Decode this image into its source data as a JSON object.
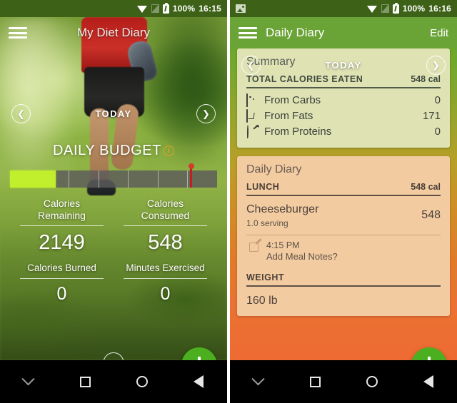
{
  "colors": {
    "brand_green": "#6aa336",
    "status_bar": "#3f6318",
    "fab_green": "#4caf20",
    "progress_fill": "#c2ef2d",
    "progress_marker": "#c22020",
    "info_orange": "#e8a02c",
    "summary_card": "#dfe3b4",
    "diary_card": "#f3cba1"
  },
  "left_phone": {
    "status_bar": {
      "wifi_icon": "wifi-icon",
      "sim_icon": "sim-signal-icon",
      "battery_icon": "battery-charging-icon",
      "battery_text": "100%",
      "time": "16:15"
    },
    "appbar": {
      "menu_icon": "hamburger-menu-icon",
      "title": "My Diet Diary"
    },
    "daynav": {
      "prev_icon": "chevron-left-icon",
      "label": "TODAY",
      "next_icon": "chevron-right-icon"
    },
    "budget": {
      "title": "DAILY BUDGET",
      "info_icon": "info-icon",
      "progress_percent": 22,
      "marker_percent": 87,
      "segments": 7
    },
    "stats": [
      {
        "label": "Calories\nRemaining",
        "value": "2149"
      },
      {
        "label": "Calories\nConsumed",
        "value": "548"
      },
      {
        "label": "Calories Burned",
        "value": "0"
      },
      {
        "label": "Minutes Exercised",
        "value": "0"
      }
    ],
    "stats_row1": {
      "left_label_line1": "Calories",
      "left_label_line2": "Remaining",
      "left_value": "2149",
      "right_label_line1": "Calories",
      "right_label_line2": "Consumed",
      "right_value": "548"
    },
    "stats_row2": {
      "left_label": "Calories Burned",
      "left_value": "0",
      "right_label": "Minutes Exercised",
      "right_value": "0"
    },
    "up_button_icon": "scroll-up-icon",
    "fab_icon": "add-plus-icon",
    "navbar": {
      "collapse_icon": "chevron-down-icon",
      "recents_icon": "recents-square-icon",
      "home_icon": "home-circle-icon",
      "back_icon": "back-triangle-icon"
    }
  },
  "right_phone": {
    "status_bar": {
      "notification_icon": "photo-notification-icon",
      "wifi_icon": "wifi-icon",
      "sim_icon": "sim-signal-icon",
      "battery_icon": "battery-charging-icon",
      "battery_text": "100%",
      "time": "16:16"
    },
    "appbar": {
      "menu_icon": "hamburger-menu-icon",
      "title": "Daily Diary",
      "action": "Edit"
    },
    "daynav": {
      "prev_icon": "chevron-left-icon",
      "label": "TODAY",
      "next_icon": "chevron-right-icon"
    },
    "summary_card": {
      "title": "Summary",
      "total_label": "TOTAL CALORIES EATEN",
      "total_value": "548 cal",
      "macros": [
        {
          "icon": "bread-slice-icon",
          "name": "From Carbs",
          "value": "0"
        },
        {
          "icon": "butter-block-icon",
          "name": "From Fats",
          "value": "171"
        },
        {
          "icon": "drumstick-icon",
          "name": "From Proteins",
          "value": "0"
        }
      ]
    },
    "diary_card": {
      "title": "Daily Diary",
      "lunch": {
        "label": "LUNCH",
        "value": "548 cal",
        "entry": {
          "name": "Cheeseburger",
          "serving": "1.0 serving",
          "calories": "548"
        },
        "note": {
          "icon": "meal-note-edit-icon",
          "time": "4:15 PM",
          "text": "Add Meal Notes?"
        }
      },
      "weight": {
        "label": "WEIGHT",
        "value": "160 lb"
      }
    },
    "fab_icon": "add-plus-icon",
    "navbar": {
      "collapse_icon": "chevron-down-icon",
      "recents_icon": "recents-square-icon",
      "home_icon": "home-circle-icon",
      "back_icon": "back-triangle-icon"
    }
  }
}
